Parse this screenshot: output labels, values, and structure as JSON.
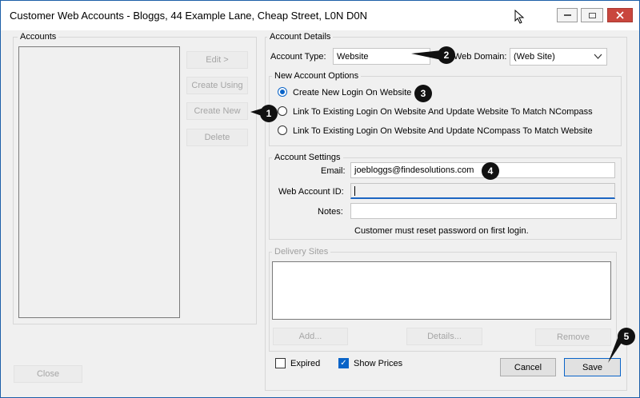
{
  "window": {
    "title": "Customer Web Accounts - Bloggs, 44 Example Lane, Cheap Street, L0N D0N"
  },
  "accounts": {
    "group_label": "Accounts",
    "edit_label": "Edit >",
    "create_using_label": "Create Using",
    "create_new_label": "Create New",
    "delete_label": "Delete",
    "close_label": "Close"
  },
  "account_details": {
    "group_label": "Account Details",
    "account_type_label": "Account Type:",
    "account_type_value": "Website",
    "web_domain_label": "Web Domain:",
    "web_domain_value": "(Web Site)"
  },
  "new_account_options": {
    "group_label": "New Account Options",
    "options": [
      {
        "label": "Create New Login On Website",
        "selected": true
      },
      {
        "label": "Link To Existing Login On Website And Update Website To Match NCompass",
        "selected": false
      },
      {
        "label": "Link To Existing Login On Website And Update NCompass To Match Website",
        "selected": false
      }
    ]
  },
  "account_settings": {
    "group_label": "Account Settings",
    "email_label": "Email:",
    "email_value": "joebloggs@findesolutions.com",
    "web_account_id_label": "Web Account ID:",
    "web_account_id_value": "",
    "notes_label": "Notes:",
    "notes_value": "",
    "reset_note": "Customer must reset password on first login."
  },
  "delivery_sites": {
    "group_label": "Delivery Sites",
    "add_label": "Add...",
    "details_label": "Details...",
    "remove_label": "Remove"
  },
  "footer": {
    "expired_label": "Expired",
    "expired_checked": false,
    "show_prices_label": "Show Prices",
    "show_prices_checked": true,
    "cancel_label": "Cancel",
    "save_label": "Save"
  },
  "callouts": [
    "1",
    "2",
    "3",
    "4",
    "5"
  ],
  "colors": {
    "accent": "#0a64c8",
    "close_button": "#c9463d",
    "callout": "#111111"
  }
}
